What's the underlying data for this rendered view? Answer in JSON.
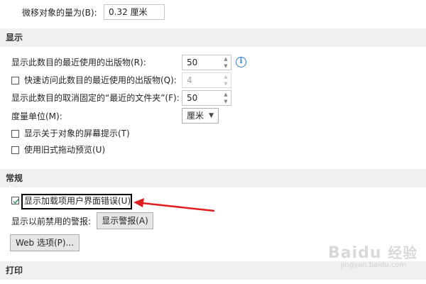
{
  "top": {
    "nudge_label": "微移对象的量为(B):",
    "nudge_value": "0.32 厘米"
  },
  "display": {
    "header": "显示",
    "recent_docs_label": "显示此数目的最近使用的出版物(R):",
    "recent_docs_value": "50",
    "quick_access_label": "快速访问此数目的最近使用的出版物(Q):",
    "quick_access_value": "4",
    "quick_access_checked": false,
    "unpinned_folders_label": "显示此数目的取消固定的“最近的文件夹”(F):",
    "unpinned_folders_value": "50",
    "units_label": "度量单位(M):",
    "units_value": "厘米",
    "screentips_label": "显示关于对象的屏幕提示(T)",
    "screentips_checked": false,
    "legacy_drag_label": "使用旧式拖动预览(U)",
    "legacy_drag_checked": false
  },
  "general": {
    "header": "常规",
    "addin_errors_label": "显示加载项用户界面错误(U)",
    "addin_errors_checked": true,
    "disabled_alerts_label": "显示以前禁用的警报:",
    "show_alerts_button": "显示警报(A)",
    "web_options_button": "Web 选项(P)..."
  },
  "print": {
    "header": "打印"
  },
  "icons": [
    "info-icon",
    "checkmark-icon",
    "spin-up-icon",
    "spin-down-icon",
    "dropdown-arrow-icon",
    "red-arrow-icon"
  ],
  "colors": {
    "section_bg": "#f0f0f0",
    "accent_arrow": "#e02020",
    "info_blue": "#2b79d6",
    "check_green": "#2e8b57"
  },
  "watermark": {
    "brand": "Baidu",
    "sub": "经验",
    "url": "jingyan.baidu.com"
  }
}
